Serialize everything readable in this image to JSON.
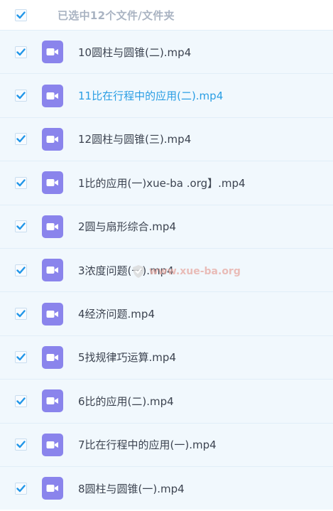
{
  "header": {
    "title": "已选中12个文件/文件夹",
    "select_all_checked": true
  },
  "files": [
    {
      "name": "10圆柱与圆锥(二).mp4",
      "icon": "video-icon",
      "checked": true
    },
    {
      "name": "11比在行程中的应用(二).mp4",
      "icon": "video-icon",
      "checked": true,
      "highlight": true
    },
    {
      "name": "12圆柱与圆锥(三).mp4",
      "icon": "video-icon",
      "checked": true
    },
    {
      "name": "1比的应用(一)xue-ba .org】.mp4",
      "icon": "video-icon",
      "checked": true
    },
    {
      "name": "2圆与扇形综合.mp4",
      "icon": "video-icon",
      "checked": true
    },
    {
      "name": "3浓度问题(一).mp4",
      "icon": "video-icon",
      "checked": true
    },
    {
      "name": "4经济问题.mp4",
      "icon": "video-icon",
      "checked": true
    },
    {
      "name": "5找规律巧运算.mp4",
      "icon": "video-icon",
      "checked": true
    },
    {
      "name": "6比的应用(二).mp4",
      "icon": "video-icon",
      "checked": true
    },
    {
      "name": "7比在行程中的应用(一).mp4",
      "icon": "video-icon",
      "checked": true
    },
    {
      "name": "8圆柱与圆锥(一).mp4",
      "icon": "video-icon",
      "checked": true
    }
  ],
  "watermark": {
    "text": "www.xue-ba.org"
  },
  "colors": {
    "accent": "#2a9ee4",
    "file_icon": "#8a84ec",
    "row_background": "#f1f8fd"
  }
}
